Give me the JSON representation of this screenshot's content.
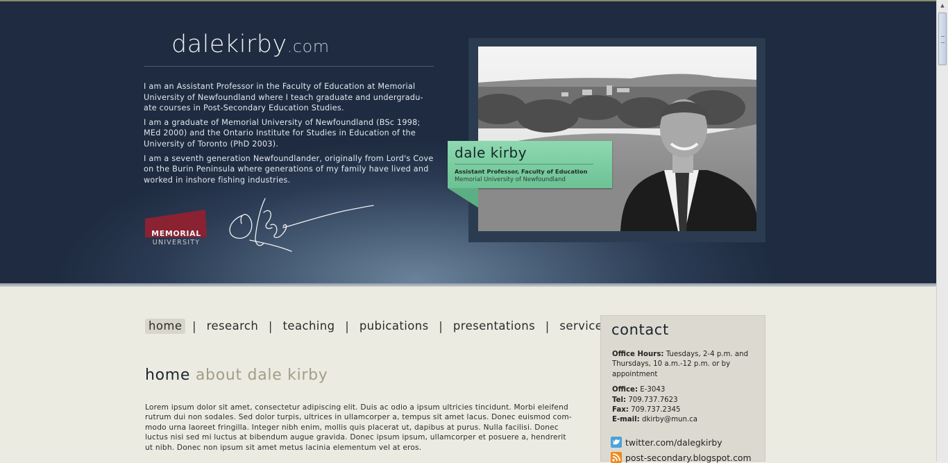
{
  "site": {
    "logo_name": "dalekirby",
    "logo_domain": ".com"
  },
  "bio": [
    "I am an Assistant Professor in the Faculty of Education at Memorial University of Newfoundland where I teach graduate and undergradu-ate courses in Post-Secondary Education Studies.",
    "I am a graduate of Memorial University of Newfoundland (BSc 1998; MEd 2000) and the Ontario Institute for Studies in Education of the University of Toronto (PhD 2003).",
    "I am a seventh generation Newfoundlander, originally from Lord's Cove on the Burin Peninsula where generations of my family have lived and worked in inshore fishing industries."
  ],
  "mun_logo": {
    "line1": "MEMORIAL",
    "line2": "UNIVERSITY",
    "color": "#8a2232"
  },
  "namecard": {
    "name": "dale kirby",
    "title": "Assistant Professor, Faculty of Education",
    "org": "Memorial University of Newfoundland",
    "color": "#7fcea3"
  },
  "nav": {
    "items": [
      "home",
      "research",
      "teaching",
      "pubications",
      "presentations",
      "service"
    ],
    "separator": "|",
    "active": "home"
  },
  "page": {
    "heading_main": "home",
    "heading_sub": "about dale kirby",
    "lorem": "Lorem ipsum dolor sit amet, consectetur adipiscing elit. Duis ac odio a ipsum ultricies tincidunt. Morbi eleifend rutrum dui non sodales. Sed dolor turpis, ultrices in ullamcorper a, tempus sit amet lacus. Donec euismod com-modo urna laoreet fringilla. Integer nibh enim, mollis quis placerat ut, dapibus at purus. Nulla facilisi. Donec luctus nisi sed mi luctus at bibendum augue gravida. Donec ipsum ipsum, ullamcorper et posuere a, hendrerit ut nibh. Donec non ipsum sit amet metus lacinia elementum vel at eros."
  },
  "contact": {
    "heading": "contact",
    "hours_label": "Office Hours:",
    "hours_value": "Tuesdays, 2-4 p.m. and Thursdays, 10 a.m.-12 p.m. or by appointment",
    "office_label": "Office:",
    "office_value": "E-3043",
    "tel_label": "Tel:",
    "tel_value": "709.737.7623",
    "fax_label": "Fax:",
    "fax_value": "709.737.2345",
    "email_label": "E-mail:",
    "email_value": "dkirby@mun.ca",
    "twitter": "twitter.com/dalegkirby",
    "blog": "post-secondary.blogspot.com",
    "twitter_icon": "twitter-bird-icon",
    "rss_icon": "rss-icon"
  }
}
